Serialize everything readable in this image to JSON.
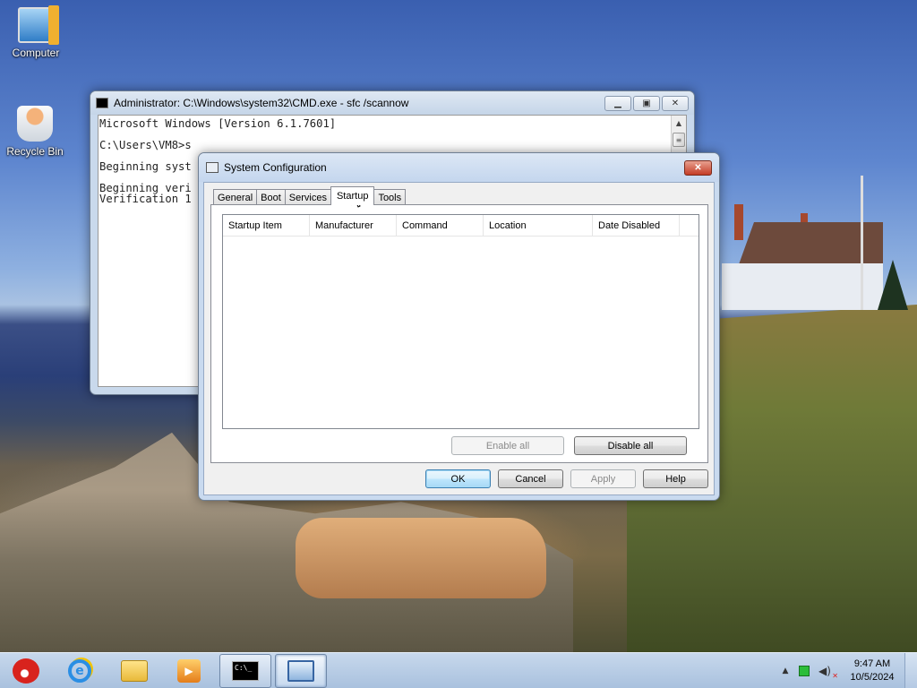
{
  "desktop": {
    "icons": [
      {
        "label": "Computer",
        "icon": "computer-icon"
      },
      {
        "label": "Recycle Bin",
        "icon": "recycle-bin-icon"
      }
    ]
  },
  "cmd_window": {
    "title": "Administrator: C:\\Windows\\system32\\CMD.exe - sfc  /scannow",
    "lines": [
      "Microsoft Windows [Version 6.1.7601]",
      "",
      "C:\\Users\\VM8>s",
      "",
      "Beginning syst",
      "",
      "Beginning veri",
      "Verification 1"
    ]
  },
  "msconfig": {
    "title": "System Configuration",
    "tabs": [
      "General",
      "Boot",
      "Services",
      "Startup",
      "Tools"
    ],
    "active_tab": "Startup",
    "columns": [
      "Startup Item",
      "Manufacturer",
      "Command",
      "Location",
      "Date Disabled"
    ],
    "rows": [],
    "buttons": {
      "enable_all": "Enable all",
      "disable_all": "Disable all",
      "ok": "OK",
      "cancel": "Cancel",
      "apply": "Apply",
      "help": "Help"
    }
  },
  "taskbar": {
    "pinned": [
      "angry-birds-icon",
      "internet-explorer-icon",
      "windows-explorer-icon",
      "media-player-icon",
      "cmd-icon",
      "system-configuration-icon"
    ],
    "clock_time": "9:47 AM",
    "clock_date": "10/5/2024"
  }
}
